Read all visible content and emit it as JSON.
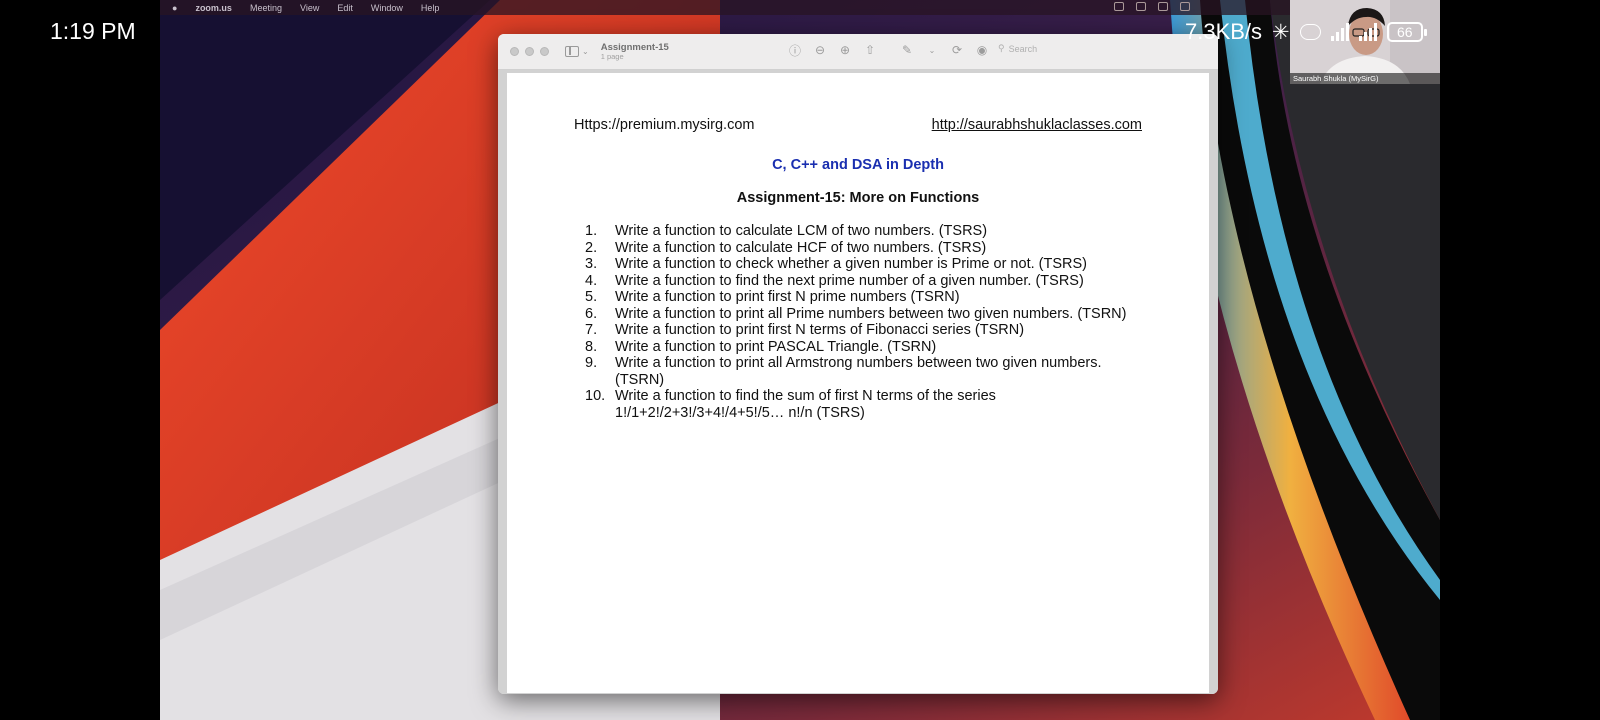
{
  "phone_status": {
    "time": "1:19 PM",
    "net_speed": "7.3KB/s",
    "battery": "66"
  },
  "menubar": {
    "items": [
      "zoom.us",
      "Meeting",
      "View",
      "Edit",
      "Window",
      "Help"
    ]
  },
  "preview_window": {
    "title": "Assignment-15",
    "subtitle": "1 page",
    "search_placeholder": "Search",
    "toolbar_icons": [
      "info-icon",
      "zoom-out-icon",
      "zoom-in-icon",
      "share-icon",
      "markup-pen-icon",
      "rotate-icon",
      "annotate-icon"
    ]
  },
  "document": {
    "url_left": "Https://premium.mysirg.com",
    "url_right": "http://saurabhshuklaclasses.com",
    "heading": "C, C++ and DSA in Depth",
    "subheading": "Assignment-15: More on Functions",
    "tasks": [
      {
        "num": "1.",
        "text": "Write a function to calculate LCM of two numbers. (TSRS)"
      },
      {
        "num": "2.",
        "text": "Write a function to calculate HCF of two numbers. (TSRS)"
      },
      {
        "num": "3.",
        "text": "Write a function to check whether a given number is Prime or not. (TSRS)"
      },
      {
        "num": "4.",
        "text": "Write a function to find the next prime number of a given number. (TSRS)"
      },
      {
        "num": "5.",
        "text": "Write a function to print first N prime numbers (TSRN)"
      },
      {
        "num": "6.",
        "text": "Write a function to print all Prime numbers between two given numbers. (TSRN)"
      },
      {
        "num": "7.",
        "text": "Write a function to print first N terms of Fibonacci series (TSRN)"
      },
      {
        "num": "8.",
        "text": "Write a function to print PASCAL Triangle. (TSRN)"
      },
      {
        "num": "9.",
        "text": "Write a function to print all Armstrong numbers between two given numbers. (TSRN)"
      },
      {
        "num": "10.",
        "text": "Write a function to find the sum of first N terms of the series 1!/1+2!/2+3!/3+4!/4+5!/5… n!/n (TSRS)"
      }
    ]
  },
  "video": {
    "participant_name": "Saurabh Shukla (MySirG)"
  },
  "colors": {
    "heading_blue": "#1a2fb0",
    "wallpaper_red": "#e0402a",
    "wallpaper_purple": "#3a1f4a"
  }
}
